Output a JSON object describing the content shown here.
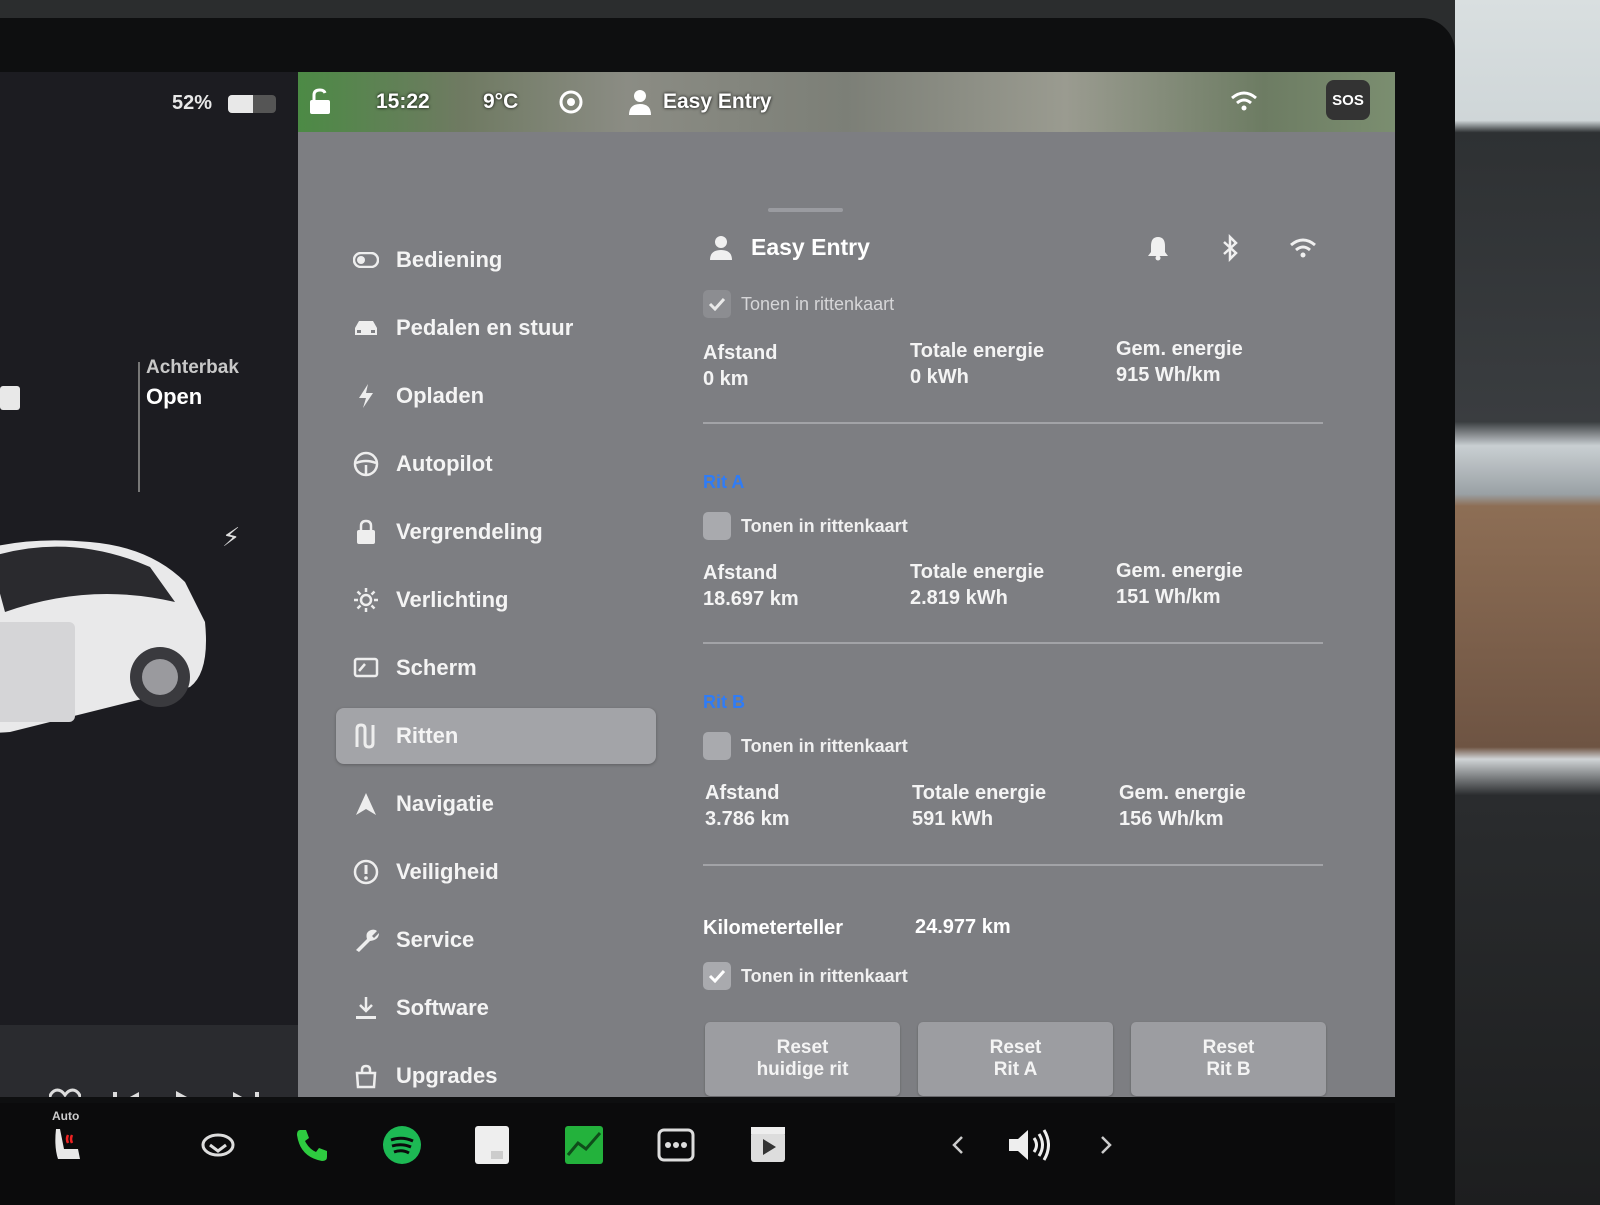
{
  "left_pane": {
    "battery_percent_text": "52%",
    "battery_level": 0.52,
    "trunk_label": "Achterbak",
    "trunk_state": "Open"
  },
  "status_bar": {
    "time": "15:22",
    "temperature": "9°C",
    "profile": "Easy Entry",
    "sos": "SOS"
  },
  "menu": {
    "items": [
      {
        "label": "Bediening",
        "icon": "toggle-icon"
      },
      {
        "label": "Pedalen en stuur",
        "icon": "car-icon"
      },
      {
        "label": "Opladen",
        "icon": "lightning-icon"
      },
      {
        "label": "Autopilot",
        "icon": "steering-wheel-icon"
      },
      {
        "label": "Vergrendeling",
        "icon": "lock-icon"
      },
      {
        "label": "Verlichting",
        "icon": "sun-icon"
      },
      {
        "label": "Scherm",
        "icon": "display-icon"
      },
      {
        "label": "Ritten",
        "icon": "trips-icon"
      },
      {
        "label": "Navigatie",
        "icon": "navigation-arrow-icon"
      },
      {
        "label": "Veiligheid",
        "icon": "alert-circle-icon"
      },
      {
        "label": "Service",
        "icon": "wrench-icon"
      },
      {
        "label": "Software",
        "icon": "download-icon"
      },
      {
        "label": "Upgrades",
        "icon": "shopping-bag-icon"
      }
    ],
    "active": "Ritten"
  },
  "content": {
    "profile_name": "Easy Entry",
    "current_trip": {
      "show_label": "Tonen in rittenkaart",
      "checked": true,
      "distance_label": "Afstand",
      "distance_value": "0 km",
      "energy_label": "Totale energie",
      "energy_value": "0 kWh",
      "avg_label": "Gem. energie",
      "avg_value": "915 Wh/km"
    },
    "trip_a": {
      "title": "Rit A",
      "show_label": "Tonen in rittenkaart",
      "checked": false,
      "distance_label": "Afstand",
      "distance_value": "18.697 km",
      "energy_label": "Totale energie",
      "energy_value": "2.819 kWh",
      "avg_label": "Gem. energie",
      "avg_value": "151 Wh/km"
    },
    "trip_b": {
      "title": "Rit B",
      "show_label": "Tonen in rittenkaart",
      "checked": false,
      "distance_label": "Afstand",
      "distance_value": "3.786 km",
      "energy_label": "Totale energie",
      "energy_value": "591 kWh",
      "avg_label": "Gem. energie",
      "avg_value": "156 Wh/km"
    },
    "odometer": {
      "label": "Kilometerteller",
      "value": "24.977 km",
      "show_label": "Tonen in rittenkaart",
      "checked": true
    },
    "buttons": {
      "reset_current": "Reset\nhuidige rit",
      "reset_a": "Reset\nRit A",
      "reset_b": "Reset\nRit B"
    }
  },
  "dock": {
    "seat_heat_label": "Auto"
  },
  "colors": {
    "panel": "#7d7e82",
    "accent_blue": "#2f7cf6",
    "spotify_green": "#1db954",
    "phone_green": "#2ecc40"
  }
}
